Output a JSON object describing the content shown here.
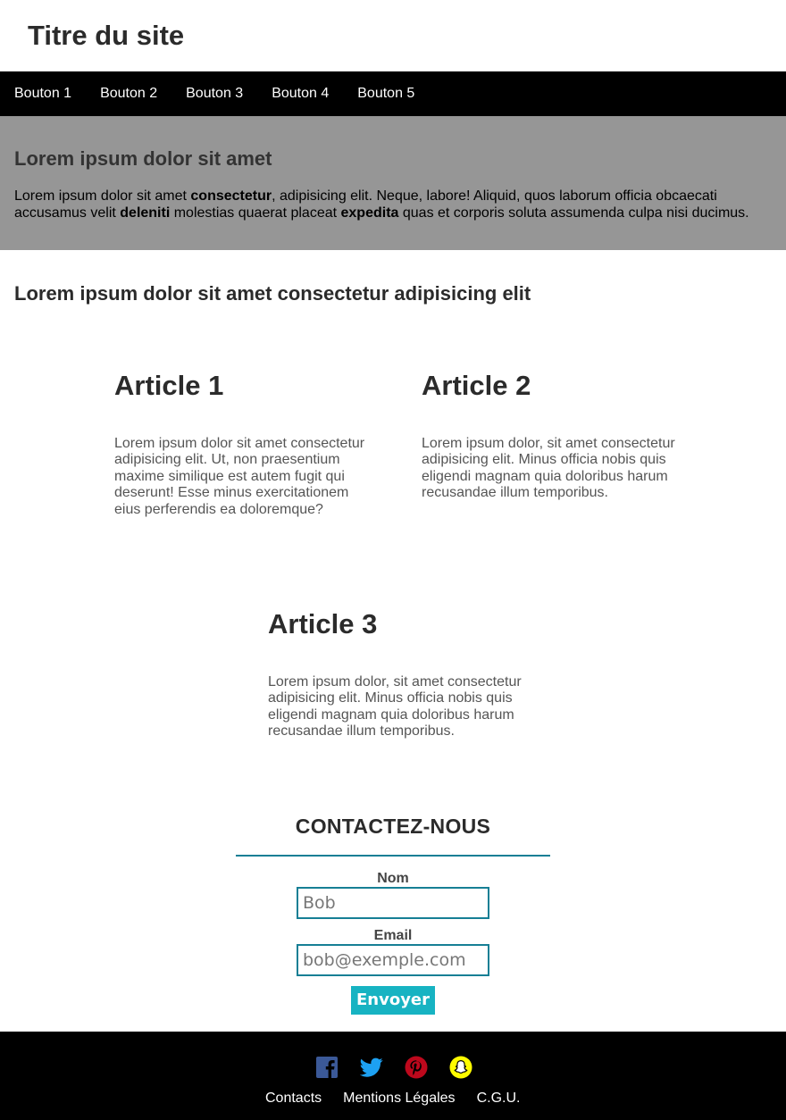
{
  "header": {
    "title": "Titre du site"
  },
  "nav": {
    "items": [
      {
        "label": "Bouton 1"
      },
      {
        "label": "Bouton 2"
      },
      {
        "label": "Bouton 3"
      },
      {
        "label": "Bouton 4"
      },
      {
        "label": "Bouton 5"
      }
    ]
  },
  "hero": {
    "title": "Lorem ipsum dolor sit amet",
    "text": [
      {
        "t": "Lorem ipsum dolor sit amet ",
        "b": false
      },
      {
        "t": "consectetur",
        "b": true
      },
      {
        "t": ", adipisicing elit. Neque, labore! Aliquid, quos laborum officia obcaecati accusamus velit ",
        "b": false
      },
      {
        "t": "deleniti",
        "b": true
      },
      {
        "t": " molestias quaerat placeat ",
        "b": false
      },
      {
        "t": "expedita",
        "b": true
      },
      {
        "t": " quas et corporis soluta assumenda culpa nisi ducimus.",
        "b": false
      }
    ]
  },
  "section": {
    "title": "Lorem ipsum dolor sit amet consectetur adipisicing elit"
  },
  "articles": [
    {
      "title": "Article 1",
      "text": "Lorem ipsum dolor sit amet consectetur adipisicing elit. Ut, non praesentium maxime similique est autem fugit qui deserunt! Esse minus exercitationem eius perferendis ea doloremque?"
    },
    {
      "title": "Article 2",
      "text": "Lorem ipsum dolor, sit amet consectetur adipisicing elit. Minus officia nobis quis eligendi magnam quia doloribus harum recusandae illum temporibus."
    },
    {
      "title": "Article 3",
      "text": "Lorem ipsum dolor, sit amet consectetur adipisicing elit. Minus officia nobis quis eligendi magnam quia doloribus harum recusandae illum temporibus."
    }
  ],
  "contact": {
    "title": "CONTACTEZ-NOUS",
    "name_label": "Nom",
    "name_placeholder": "Bob",
    "email_label": "Email",
    "email_placeholder": "bob@exemple.com",
    "submit_label": "Envoyer"
  },
  "footer": {
    "socials": [
      {
        "icon": "facebook-icon",
        "color": "#3b5998"
      },
      {
        "icon": "twitter-icon",
        "color": "#1da1f2"
      },
      {
        "icon": "pinterest-icon",
        "color": "#bd081c"
      },
      {
        "icon": "snapchat-icon",
        "color": "#fffc00"
      }
    ],
    "links": [
      {
        "label": "Contacts"
      },
      {
        "label": "Mentions Légales"
      },
      {
        "label": "C.G.U."
      }
    ]
  },
  "colors": {
    "nav_bg": "#000000",
    "hero_bg": "#969696",
    "accent": "#167f95",
    "button_bg": "#17b3c2"
  }
}
